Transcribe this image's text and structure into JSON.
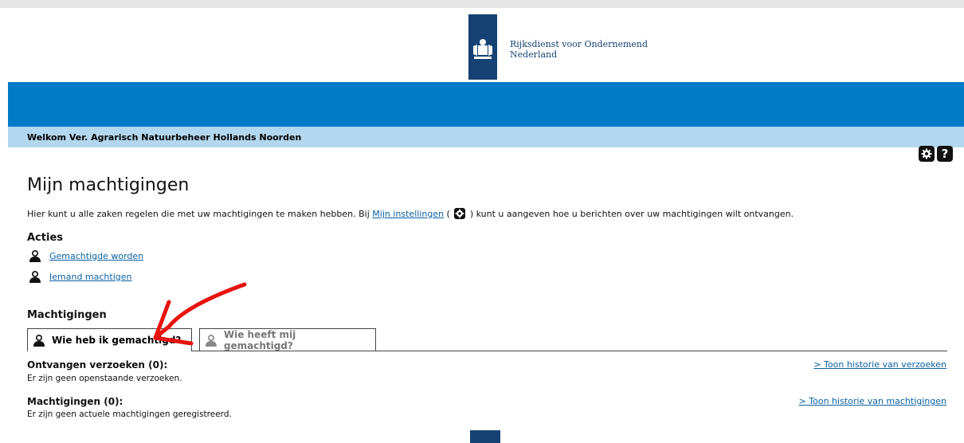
{
  "header": {
    "org_line1": "Rijksdienst voor Ondernemend",
    "org_line2": "Nederland",
    "logo_icon": "coat-of-arms-icon",
    "brand_color": "#154273",
    "band_color": "#007bc7"
  },
  "welcome": "Welkom Ver. Agrarisch Natuurbeheer Hollands Noorden",
  "toolbar": {
    "settings_icon": "gear-icon",
    "help_label": "?"
  },
  "page_title": "Mijn machtigingen",
  "intro": {
    "before": "Hier kunt u alle zaken regelen die met uw machtigingen te maken hebben. Bij ",
    "link": "Mijn instellingen",
    "middle_open": " ( ",
    "middle_close": " ) kunt u aangeven hoe u berichten over uw machtigingen wilt ontvangen."
  },
  "acties": {
    "title": "Acties",
    "items": [
      {
        "label": "Gemachtigde worden",
        "icon": "person-icon"
      },
      {
        "label": "Iemand machtigen",
        "icon": "person-icon"
      }
    ]
  },
  "machtigingen": {
    "title": "Machtigingen",
    "tabs": [
      {
        "label": "Wie heb ik gemachtigd?",
        "active": true
      },
      {
        "label": "Wie heeft mij gemachtigd?",
        "active": false
      }
    ]
  },
  "ontvangen": {
    "title": "Ontvangen verzoeken (0):",
    "text": "Er zijn geen openstaande verzoeken.",
    "link": "> Toon historie van verzoeken"
  },
  "machtigingen_list": {
    "title": "Machtigingen (0):",
    "text": "Er zijn geen actuele machtigingen geregistreerd.",
    "link": "> Toon historie van machtigingen"
  },
  "annotation": {
    "color": "#e8130f"
  }
}
